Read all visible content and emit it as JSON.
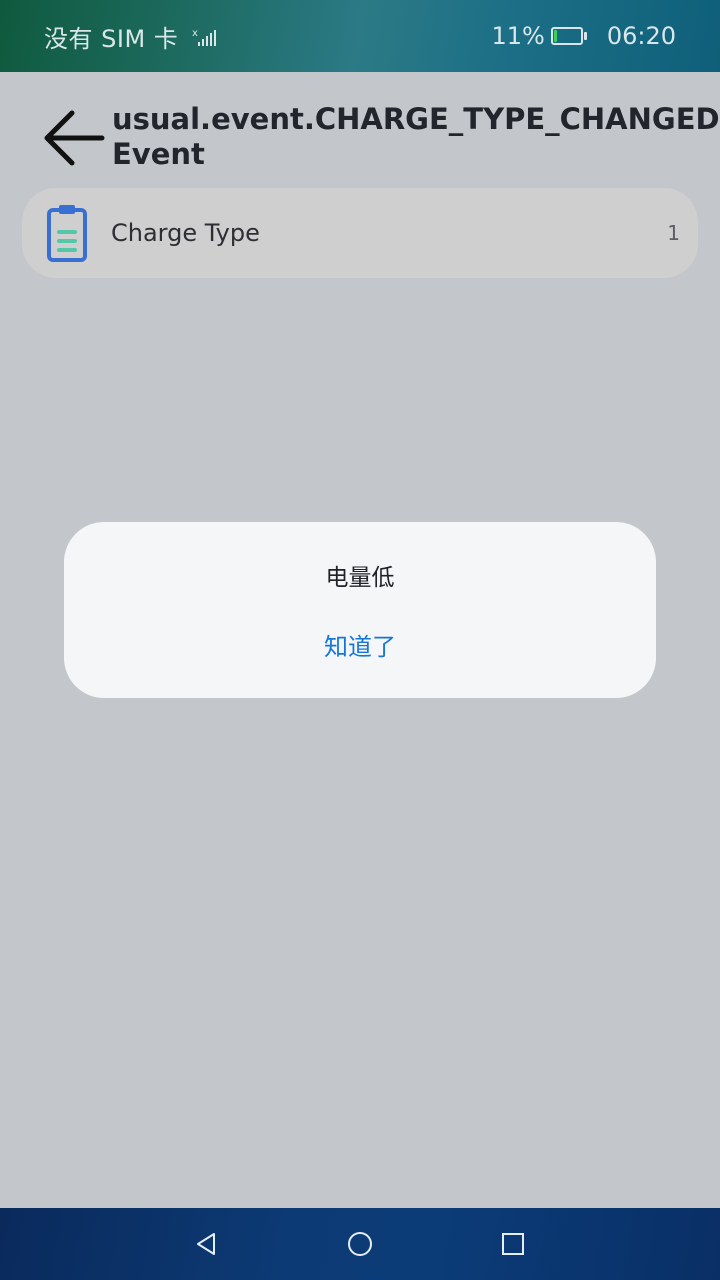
{
  "status_bar": {
    "carrier": "没有 SIM 卡",
    "battery_percent": "11%",
    "battery_level": 0.11,
    "time": "06:20"
  },
  "header": {
    "title_line1": "usual.event.CHARGE_TYPE_CHANGED",
    "title_line2": "Event"
  },
  "row": {
    "icon": "clipboard-icon",
    "label": "Charge Type",
    "value": "1"
  },
  "dialog": {
    "message": "电量低",
    "button_label": "知道了"
  },
  "nav_bar": {
    "icons": [
      "back-triangle-icon",
      "home-circle-icon",
      "recents-square-icon"
    ]
  },
  "colors": {
    "accent": "#1477d8",
    "icon_blue": "#3a6fd2",
    "icon_teal": "#54c7a8",
    "background": "#c3c6cb"
  }
}
